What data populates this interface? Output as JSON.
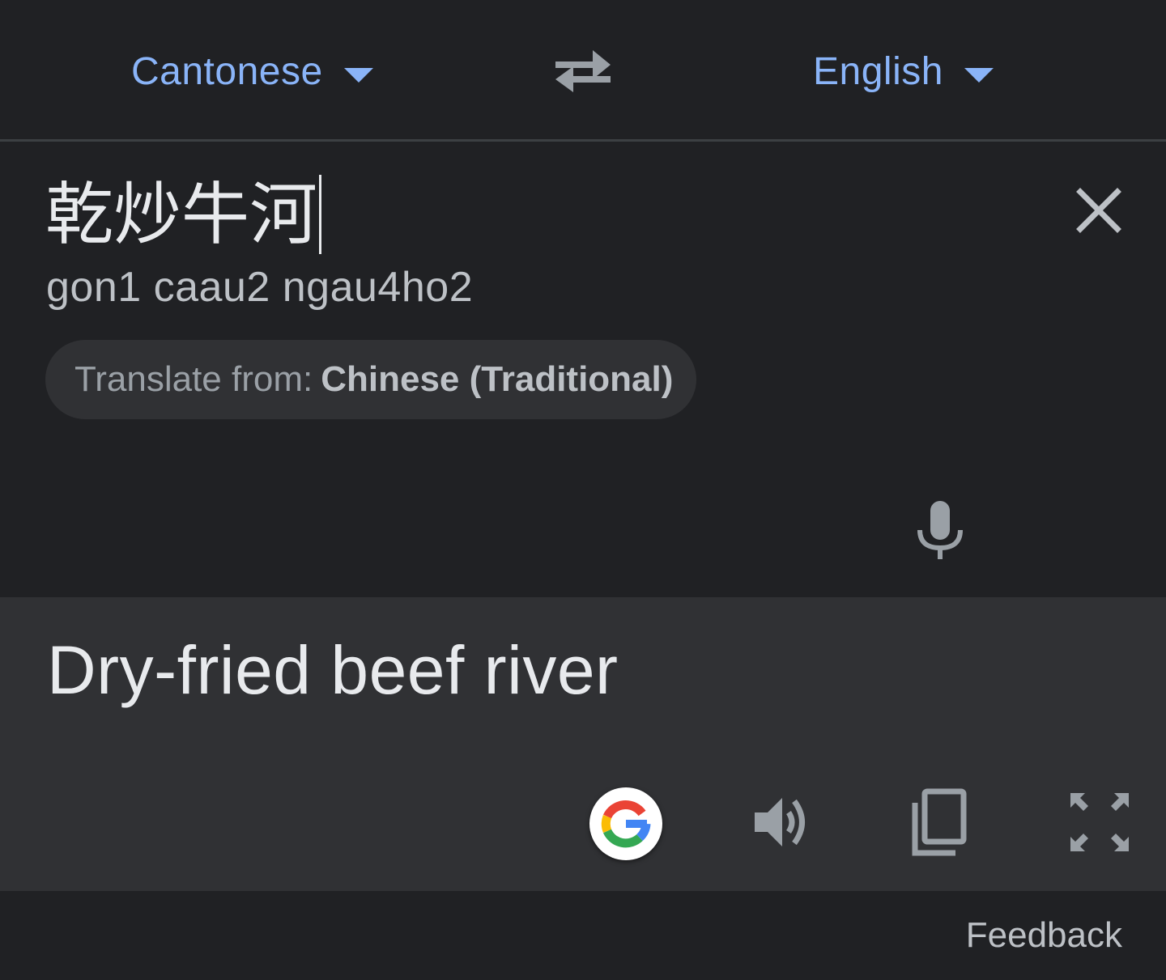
{
  "header": {
    "source_language": "Cantonese",
    "target_language": "English"
  },
  "input": {
    "text": "乾炒牛河",
    "romanization": "gon1 caau2 ngau4ho2",
    "detect_chip": {
      "prefix": "Translate from:",
      "language": "Chinese (Traditional)"
    }
  },
  "output": {
    "translation": "Dry-fried beef river"
  },
  "footer": {
    "feedback_label": "Feedback"
  },
  "icons": {
    "swap": "swap-languages-icon",
    "clear": "close-icon",
    "mic": "microphone-icon",
    "google": "google-logo-icon",
    "speak": "volume-icon",
    "copy": "copy-icon",
    "fullscreen": "fullscreen-icon"
  },
  "colors": {
    "background": "#202124",
    "output_background": "#303134",
    "accent": "#8ab4f8",
    "text_primary": "#e8eaed",
    "text_secondary": "#bdc1c6",
    "icon": "#9aa0a6"
  }
}
